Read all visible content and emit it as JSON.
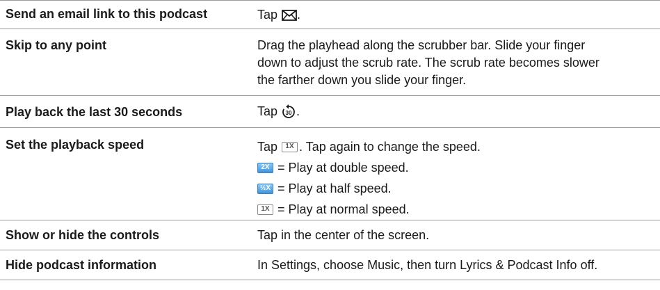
{
  "rows": [
    {
      "label": "Send an email link to this podcast",
      "desc": {
        "before": "Tap",
        "after": ".",
        "icon": "envelope-icon"
      }
    },
    {
      "label": "Skip to any point",
      "desc_lines": [
        "Drag the playhead along the scrubber bar. Slide your finger",
        "down to adjust the scrub rate. The scrub rate becomes slower",
        "the farther down you slide your finger."
      ]
    },
    {
      "label": "Play back the last 30 seconds",
      "desc": {
        "before": "Tap",
        "after": ".",
        "icon": "replay-30-icon",
        "icon_text": "30"
      }
    },
    {
      "label": "Set the playback speed",
      "speed": {
        "line1_before": "Tap",
        "line1_badge": "1X",
        "line1_after": ". Tap again to change the speed.",
        "items": [
          {
            "badge": "2X",
            "style": "blue",
            "text": "= Play at double speed."
          },
          {
            "badge": "½X",
            "style": "blue",
            "text": "= Play at half speed."
          },
          {
            "badge": "1X",
            "style": "outline",
            "text": "= Play at normal speed."
          }
        ]
      }
    },
    {
      "label": "Show or hide the controls",
      "desc_text": "Tap in the center of the screen."
    },
    {
      "label": "Hide podcast information",
      "desc_text": "In Settings, choose Music, then turn Lyrics & Podcast Info off."
    }
  ],
  "colors": {
    "rule": "#9a9a9a",
    "badge_blue": "#3d95dc"
  }
}
